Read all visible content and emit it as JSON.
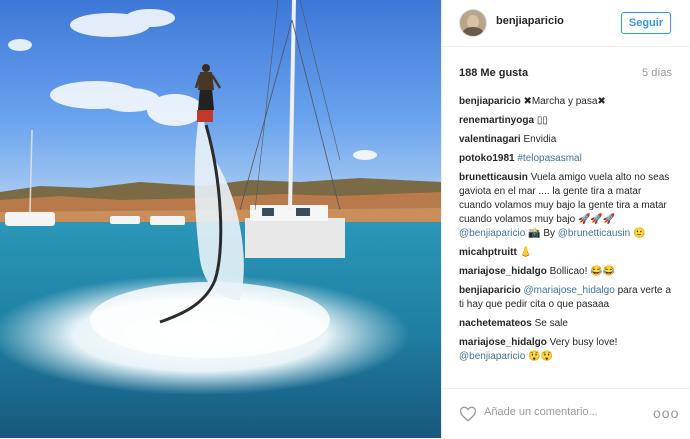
{
  "post": {
    "username": "benjiaparicio",
    "follow_label": "Seguir",
    "likes": "188 Me gusta",
    "date": "5 días"
  },
  "comments": [
    {
      "user": "benjiaparicio",
      "text": "✖Marcha y pasa✖"
    },
    {
      "user": "renemartinyoga",
      "text": "▯▯"
    },
    {
      "user": "valentinagari",
      "text": "Envidia"
    },
    {
      "user": "potoko1981",
      "text": "",
      "tag": "#telopasasmal"
    },
    {
      "user": "brunetticausin",
      "text": "Vuela amigo vuela alto no seas gaviota en el mar .... la gente tira a matar cuando volamos muy bajo la gente tira a matar cuando volamos muy bajo 🚀🚀🚀",
      "mention": "@benjiaparicio",
      "text_after": "📸 By",
      "mention2": "@brunetticausin",
      "emoji_end": "🙂"
    },
    {
      "user": "micahptruitt",
      "text": "👃"
    },
    {
      "user": "mariajose_hidalgo",
      "text": "Bollicao! 😂😂"
    },
    {
      "user": "benjiaparicio",
      "mention": "@mariajose_hidalgo",
      "text": "para verte a ti hay que pedir cita o que pasaaa"
    },
    {
      "user": "nachetemateos",
      "text": "Se sale"
    },
    {
      "user": "mariajose_hidalgo",
      "text": "Very busy love!",
      "mention": "@benjiaparicio",
      "emoji_end": "😲😲"
    }
  ],
  "footer": {
    "placeholder": "Añade un comentario...",
    "more": "ooo"
  },
  "icons": {
    "like": "heart-icon",
    "options": "more-options-icon",
    "avatar": "avatar"
  }
}
